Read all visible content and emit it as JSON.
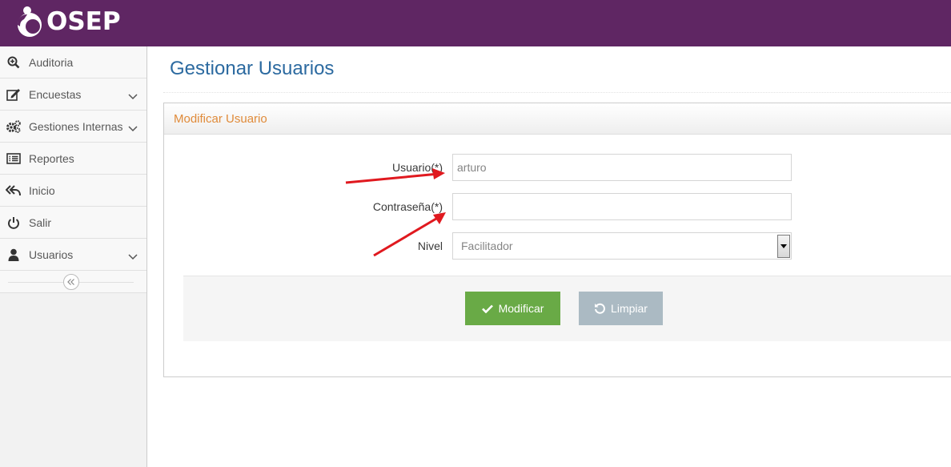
{
  "brand": {
    "name": "OSEP",
    "bar_color": "#5f2663"
  },
  "sidebar": {
    "items": [
      {
        "label": "Auditoria",
        "icon": "search-plus-icon",
        "has_submenu": false
      },
      {
        "label": "Encuestas",
        "icon": "edit-icon",
        "has_submenu": true
      },
      {
        "label": "Gestiones Internas",
        "icon": "cogs-icon",
        "has_submenu": true
      },
      {
        "label": "Reportes",
        "icon": "list-alt-icon",
        "has_submenu": false
      },
      {
        "label": "Inicio",
        "icon": "reply-all-icon",
        "has_submenu": false
      },
      {
        "label": "Salir",
        "icon": "power-off-icon",
        "has_submenu": false
      },
      {
        "label": "Usuarios",
        "icon": "user-icon",
        "has_submenu": true
      }
    ]
  },
  "page": {
    "title": "Gestionar Usuarios"
  },
  "panel": {
    "title": "Modificar Usuario",
    "title_color": "#e08b3a",
    "fields": {
      "usuario": {
        "label": "Usuario(*)",
        "value": "arturo"
      },
      "contrasena": {
        "label": "Contraseña(*)",
        "value": ""
      },
      "nivel": {
        "label": "Nivel",
        "selected": "Facilitador"
      }
    },
    "buttons": {
      "modificar": {
        "label": "Modificar",
        "color": "#69aa46",
        "icon": "check-icon"
      },
      "limpiar": {
        "label": "Limpiar",
        "color": "#abbac3",
        "icon": "undo-icon"
      }
    }
  },
  "annotations": {
    "arrow_color": "#e0191f"
  }
}
